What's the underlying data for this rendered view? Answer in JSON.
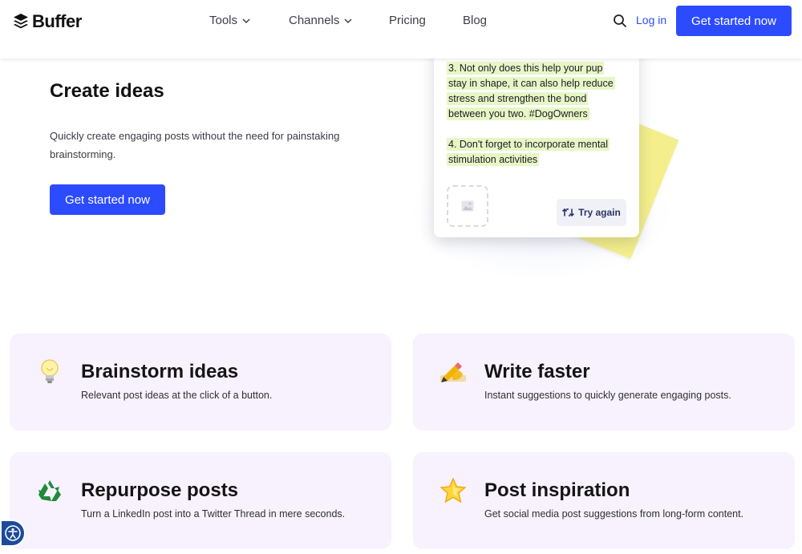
{
  "header": {
    "logo_text": "Buffer",
    "nav": [
      {
        "label": "Tools",
        "has_dropdown": true
      },
      {
        "label": "Channels",
        "has_dropdown": true
      },
      {
        "label": "Pricing",
        "has_dropdown": false
      },
      {
        "label": "Blog",
        "has_dropdown": false
      }
    ],
    "login_label": "Log in",
    "cta_label": "Get started now",
    "search_icon": "search-icon"
  },
  "hero": {
    "title": "Create ideas",
    "description": "Quickly create engaging posts without the need for painstaking brainstorming.",
    "cta_label": "Get started now"
  },
  "preview_card": {
    "paragraph_3": "3. Not only does this help your pup stay in shape, it can also help reduce stress and strengthen the bond between you two. #DogOwners",
    "paragraph_4": "4. Don't forget to incorporate mental stimulation activities",
    "try_again_label": "Try again"
  },
  "features": [
    {
      "icon": "lightbulb-icon",
      "title": "Brainstorm ideas",
      "description": "Relevant post ideas at the click of a button."
    },
    {
      "icon": "writing-hand-icon",
      "title": "Write faster",
      "description": "Instant suggestions to quickly generate engaging posts."
    },
    {
      "icon": "recycle-icon",
      "title": "Repurpose posts",
      "description": "Turn a LinkedIn post into a Twitter Thread in mere seconds."
    },
    {
      "icon": "star-icon",
      "title": "Post inspiration",
      "description": "Get social media post suggestions from long-form content."
    }
  ],
  "colors": {
    "accent": "#2c4bff",
    "feature_bg": "#f7f2fd",
    "highlight": "#e7f6c6",
    "sticky_note": "#f4ef8c"
  }
}
